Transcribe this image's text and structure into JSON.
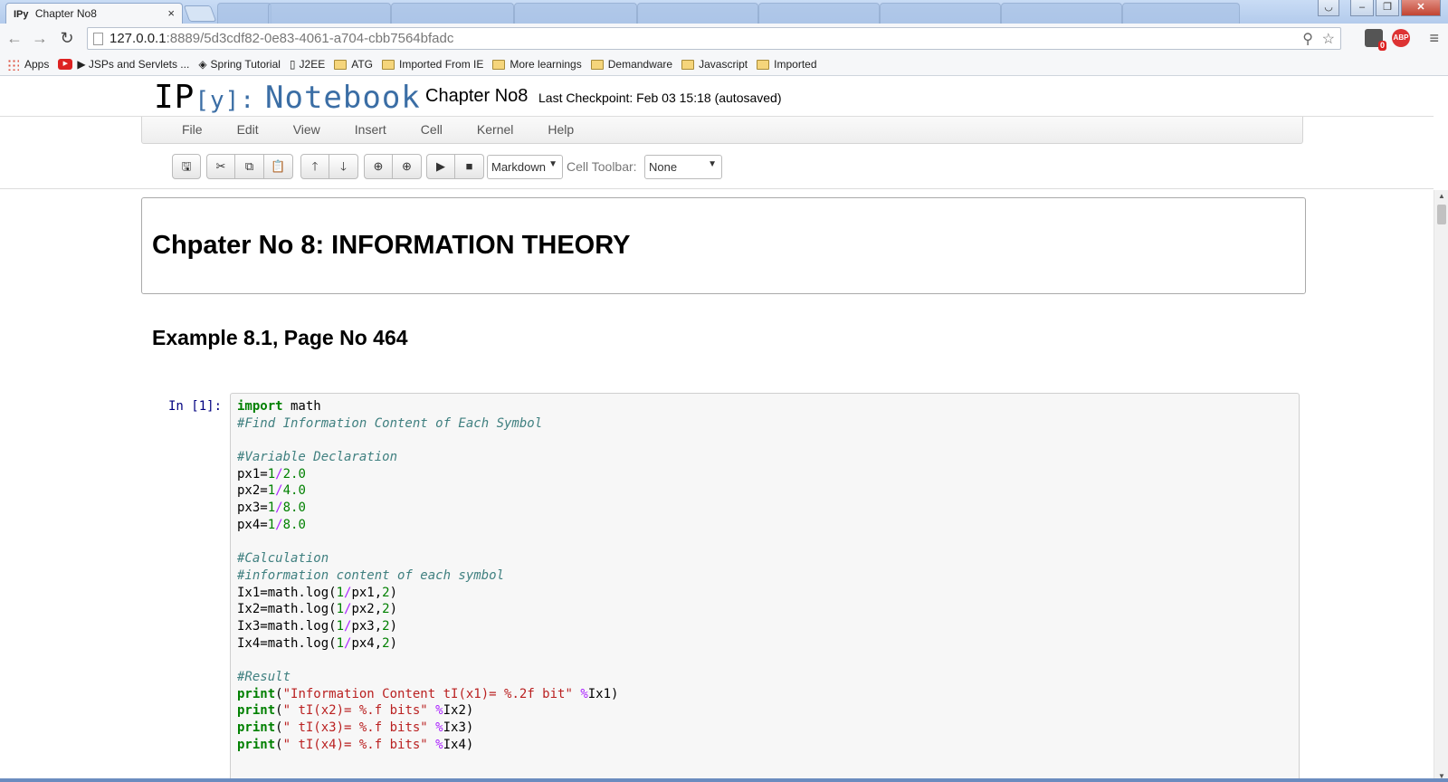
{
  "browser": {
    "active_tab": {
      "favicon": "IPy",
      "title": "Chapter No8",
      "close": "×"
    },
    "inactive_tabs": [
      "",
      "",
      "",
      "",
      "",
      "",
      "",
      "",
      "",
      "",
      ""
    ],
    "address": {
      "host": "127.0.0.1",
      "path": ":8889/5d3cdf82-0e83-4061-a704-cbb7564bfadc"
    },
    "extensions": {
      "badge_count": "0",
      "abp_label": "ABP"
    },
    "bookmarks": [
      {
        "label": "Apps",
        "icon": "apps-grid-icon"
      },
      {
        "label": "▶ JSPs and Servlets ...",
        "icon": "youtube-icon"
      },
      {
        "label": "Spring Tutorial",
        "icon": "spring-icon"
      },
      {
        "label": "J2EE",
        "icon": "page-icon"
      },
      {
        "label": "ATG",
        "icon": "folder-icon"
      },
      {
        "label": "Imported From IE",
        "icon": "folder-icon"
      },
      {
        "label": "More learnings",
        "icon": "folder-icon"
      },
      {
        "label": "Demandware",
        "icon": "folder-icon"
      },
      {
        "label": "Javascript",
        "icon": "folder-icon"
      },
      {
        "label": "Imported",
        "icon": "folder-icon"
      }
    ]
  },
  "notebook": {
    "logo": {
      "ip": "IP",
      "y": "[y]:",
      "word": "Notebook"
    },
    "title": "Chapter No8",
    "checkpoint": "Last Checkpoint: Feb 03 15:18 (autosaved)",
    "menu": [
      "File",
      "Edit",
      "View",
      "Insert",
      "Cell",
      "Kernel",
      "Help"
    ],
    "cell_type": "Markdown",
    "cell_toolbar_label": "Cell Toolbar:",
    "cell_toolbar_value": "None",
    "heading1": "Chpater No 8: INFORMATION THEORY",
    "heading2": "Example 8.1, Page No 464",
    "prompt": "In [1]:",
    "code": {
      "l1_kw": "import",
      "l1_rest": " math",
      "l2": "#Find Information Content of Each Symbol",
      "l4": "#Variable Declaration",
      "px1": "px1=",
      "px1_a": "1",
      "px1_op": "/",
      "px1_b": "2.0",
      "px2": "px2=",
      "px2_a": "1",
      "px2_op": "/",
      "px2_b": "4.0",
      "px3": "px3=",
      "px3_a": "1",
      "px3_op": "/",
      "px3_b": "8.0",
      "px4": "px4=",
      "px4_a": "1",
      "px4_op": "/",
      "px4_b": "8.0",
      "l10": "#Calculation",
      "l11": "#information content of each symbol",
      "ix1_a": "Ix1=math.log(",
      "ix1_n": "1",
      "ix1_op": "/",
      "ix1_b": "px1,",
      "ix1_n2": "2",
      "ix1_c": ")",
      "ix2_a": "Ix2=math.log(",
      "ix2_n": "1",
      "ix2_op": "/",
      "ix2_b": "px2,",
      "ix2_n2": "2",
      "ix2_c": ")",
      "ix3_a": "Ix3=math.log(",
      "ix3_n": "1",
      "ix3_op": "/",
      "ix3_b": "px3,",
      "ix3_n2": "2",
      "ix3_c": ")",
      "ix4_a": "Ix4=math.log(",
      "ix4_n": "1",
      "ix4_op": "/",
      "ix4_b": "px4,",
      "ix4_n2": "2",
      "ix4_c": ")",
      "l17": "#Result",
      "p1_kw": "print",
      "p1_o": "(",
      "p1_s": "\"Information Content tI(x1)= %.2f bit\"",
      "p1_op": " %",
      "p1_r": "Ix1)",
      "p2_kw": "print",
      "p2_o": "(",
      "p2_s": "\" tI(x2)= %.f bits\"",
      "p2_op": " %",
      "p2_r": "Ix2)",
      "p3_kw": "print",
      "p3_o": "(",
      "p3_s": "\" tI(x3)= %.f bits\"",
      "p3_op": " %",
      "p3_r": "Ix3)",
      "p4_kw": "print",
      "p4_o": "(",
      "p4_s": "\" tI(x4)= %.f bits\"",
      "p4_op": " %",
      "p4_r": "Ix4)"
    }
  }
}
